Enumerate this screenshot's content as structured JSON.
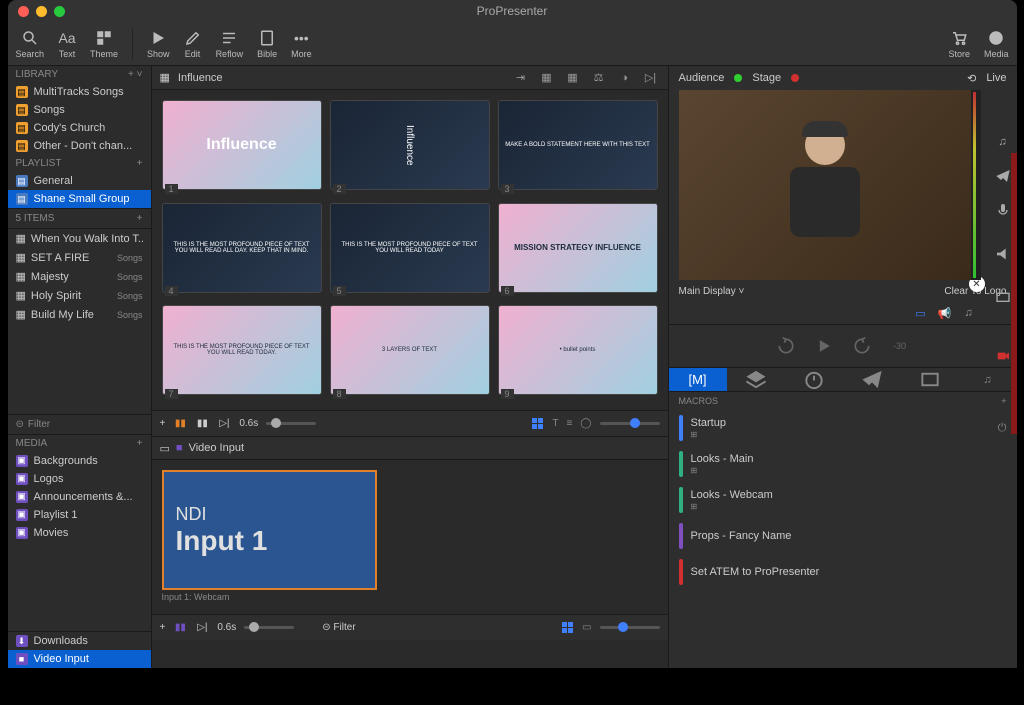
{
  "app": {
    "title": "ProPresenter"
  },
  "toolbar": {
    "search": "Search",
    "text": "Text",
    "theme": "Theme",
    "show": "Show",
    "edit": "Edit",
    "reflow": "Reflow",
    "bible": "Bible",
    "more": "More",
    "store": "Store",
    "media": "Media"
  },
  "library": {
    "header": "LIBRARY",
    "items": [
      {
        "name": "MultiTracks Songs"
      },
      {
        "name": "Songs"
      },
      {
        "name": "Cody's Church"
      },
      {
        "name": "Other - Don't chan..."
      }
    ]
  },
  "playlist": {
    "header": "PLAYLIST",
    "items": [
      {
        "name": "General"
      },
      {
        "name": "Shane Small Group",
        "selected": true
      }
    ]
  },
  "items": {
    "header": "5 ITEMS",
    "list": [
      {
        "name": "When You Walk Into T...",
        "tag": ""
      },
      {
        "name": "SET A FIRE",
        "tag": "Songs"
      },
      {
        "name": "Majesty",
        "tag": "Songs"
      },
      {
        "name": "Holy Spirit",
        "tag": "Songs"
      },
      {
        "name": "Build My Life",
        "tag": "Songs"
      }
    ],
    "filter": "Filter"
  },
  "media": {
    "header": "MEDIA",
    "items": [
      {
        "name": "Backgrounds"
      },
      {
        "name": "Logos"
      },
      {
        "name": "Announcements &..."
      },
      {
        "name": "Playlist 1"
      },
      {
        "name": "Movies"
      }
    ],
    "bottom": [
      {
        "name": "Downloads"
      },
      {
        "name": "Video Input",
        "selected": true
      }
    ]
  },
  "presentation": {
    "name": "Influence",
    "slides": [
      {
        "num": "1",
        "text": "Influence",
        "big": true
      },
      {
        "num": "2",
        "text": "Influence",
        "dark": true
      },
      {
        "num": "3",
        "text": "MAKE A BOLD STATEMENT HERE WITH THIS TEXT",
        "dark": true
      },
      {
        "num": "4",
        "text": "THIS IS THE MOST PROFOUND PIECE OF TEXT YOU WILL READ ALL DAY. KEEP THAT IN MIND.",
        "dark": true
      },
      {
        "num": "5",
        "text": "THIS IS THE MOST PROFOUND PIECE OF TEXT YOU WILL READ TODAY",
        "dark": true
      },
      {
        "num": "6",
        "text": "MISSION  STRATEGY  INFLUENCE"
      },
      {
        "num": "7",
        "text": "THIS IS THE MOST PROFOUND PIECE OF TEXT YOU WILL READ TODAY."
      },
      {
        "num": "8",
        "text": "3 LAYERS OF TEXT"
      },
      {
        "num": "9",
        "text": "• bullet points"
      }
    ],
    "transition": "0.6s"
  },
  "videoInput": {
    "header": "Video Input",
    "line1": "NDI",
    "line2": "Input 1",
    "label": "Input 1: Webcam",
    "transition": "0.6s",
    "filter": "Filter"
  },
  "preview": {
    "audience": "Audience",
    "stage": "Stage",
    "live": "Live",
    "display": "Main Display",
    "clear": "Clear To Logo"
  },
  "transport": {
    "skip": "-30"
  },
  "macros": {
    "header": "MACROS",
    "items": [
      {
        "name": "Startup",
        "color": "#4080ff",
        "power": true
      },
      {
        "name": "Looks - Main",
        "color": "#30b080"
      },
      {
        "name": "Looks - Webcam",
        "color": "#30b080"
      },
      {
        "name": "Props - Fancy Name",
        "color": "#8050c0"
      },
      {
        "name": "Set ATEM to ProPresenter",
        "color": "#d03030"
      }
    ]
  }
}
